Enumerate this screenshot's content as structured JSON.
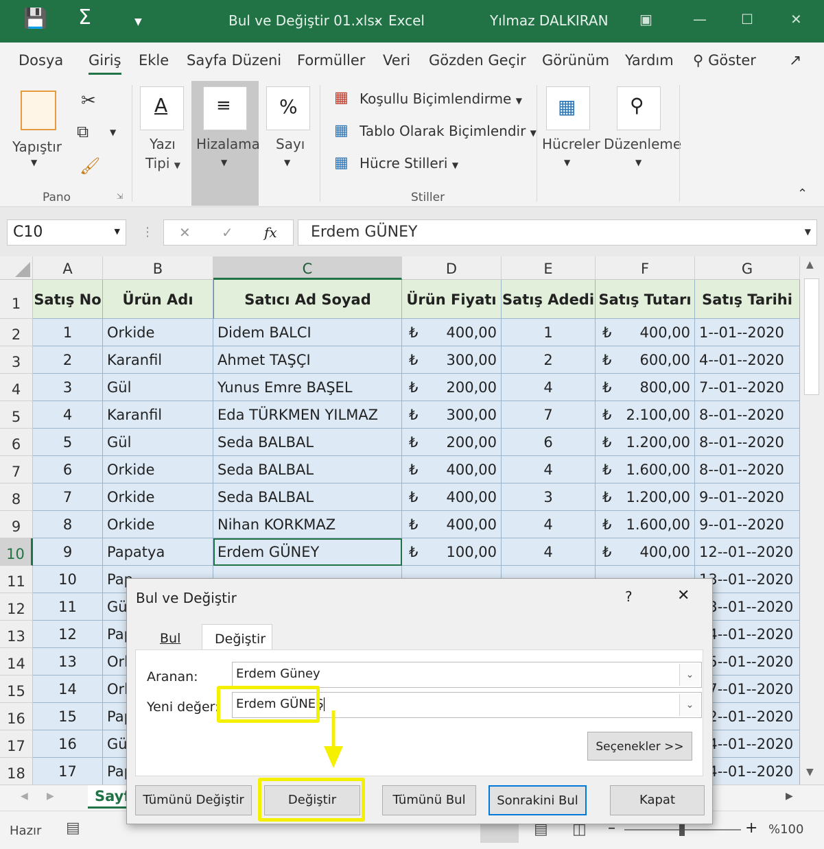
{
  "title_bar": {
    "filename": "Bul ve Değiştir 01.xlsx",
    "separator": "-",
    "app": "Excel",
    "user": "Yılmaz DALKIRAN"
  },
  "menu": {
    "tabs": [
      "Dosya",
      "Giriş",
      "Ekle",
      "Sayfa Düzeni",
      "Formüller",
      "Veri",
      "Gözden Geçir",
      "Görünüm",
      "Yardım",
      "Göster"
    ]
  },
  "ribbon": {
    "paste": "Yapıştır",
    "clipboard_group": "Pano",
    "font": "Yazı",
    "font2": "Tipi",
    "alignment": "Hizalama",
    "number": "Sayı",
    "conditional": "Koşullu Biçimlendirme",
    "table_format": "Tablo Olarak Biçimlendir",
    "cell_styles": "Hücre Stilleri",
    "styles_group": "Stiller",
    "cells": "Hücreler",
    "editing": "Düzenleme"
  },
  "formula_bar": {
    "name_box": "C10",
    "fx": "fx",
    "content": "Erdem GÜNEY"
  },
  "columns": [
    "A",
    "B",
    "C",
    "D",
    "E",
    "F",
    "G"
  ],
  "headers": [
    "Satış No",
    "Ürün Adı",
    "Satıcı Ad Soyad",
    "Ürün Fiyatı",
    "Satış Adedi",
    "Satış Tutarı",
    "Satış Tarihi"
  ],
  "currency": "₺",
  "rows": [
    [
      "1",
      "Orkide",
      "Didem BALCI",
      "400,00",
      "1",
      "400,00",
      "1--01--2020"
    ],
    [
      "2",
      "Karanfil",
      "Ahmet TAŞÇI",
      "300,00",
      "2",
      "600,00",
      "4--01--2020"
    ],
    [
      "3",
      "Gül",
      "Yunus Emre BAŞEL",
      "200,00",
      "4",
      "800,00",
      "7--01--2020"
    ],
    [
      "4",
      "Karanfil",
      "Eda TÜRKMEN YILMAZ",
      "300,00",
      "7",
      "2.100,00",
      "8--01--2020"
    ],
    [
      "5",
      "Gül",
      "Seda BALBAL",
      "200,00",
      "6",
      "1.200,00",
      "8--01--2020"
    ],
    [
      "6",
      "Orkide",
      "Seda BALBAL",
      "400,00",
      "4",
      "1.600,00",
      "8--01--2020"
    ],
    [
      "7",
      "Orkide",
      "Seda BALBAL",
      "400,00",
      "3",
      "1.200,00",
      "9--01--2020"
    ],
    [
      "8",
      "Orkide",
      "Nihan KORKMAZ",
      "400,00",
      "4",
      "1.600,00",
      "9--01--2020"
    ],
    [
      "9",
      "Papatya",
      "Erdem GÜNEY",
      "100,00",
      "4",
      "400,00",
      "12--01--2020"
    ],
    [
      "10",
      "Pap",
      "",
      "",
      "",
      "",
      "13--01--2020"
    ],
    [
      "11",
      "Gü",
      "",
      "",
      "",
      "",
      "13--01--2020"
    ],
    [
      "12",
      "Pap",
      "",
      "",
      "",
      "",
      "14--01--2020"
    ],
    [
      "13",
      "Orl",
      "",
      "",
      "",
      "",
      "15--01--2020"
    ],
    [
      "14",
      "Orl",
      "",
      "",
      "",
      "",
      "17--01--2020"
    ],
    [
      "15",
      "Pap",
      "",
      "",
      "",
      "",
      "12--01--2020"
    ],
    [
      "16",
      "Gü",
      "",
      "",
      "",
      "",
      "14--01--2020"
    ],
    [
      "17",
      "Pap",
      "",
      "",
      "",
      "",
      "14--01--2020"
    ]
  ],
  "sheet_tab": "Sayf",
  "status": {
    "ready": "Hazır",
    "zoom": "%100"
  },
  "dialog": {
    "title": "Bul ve Değiştir",
    "help": "?",
    "tab_find": "Bul",
    "tab_replace": "Değiştir",
    "find_label": "Aranan:",
    "find_value": "Erdem Güney",
    "replace_label": "Yeni değer:",
    "replace_value": "Erdem GÜNEŞ",
    "options": "Seçenekler >>",
    "replace_all": "Tümünü Değiştir",
    "replace": "Değiştir",
    "find_all": "Tümünü Bul",
    "find_next": "Sonrakini Bul",
    "close": "Kapat"
  },
  "colors": {
    "excel_green": "#217346",
    "header_fill": "#e2efda",
    "data_fill": "#dde9f5",
    "highlight": "#f4f000"
  }
}
